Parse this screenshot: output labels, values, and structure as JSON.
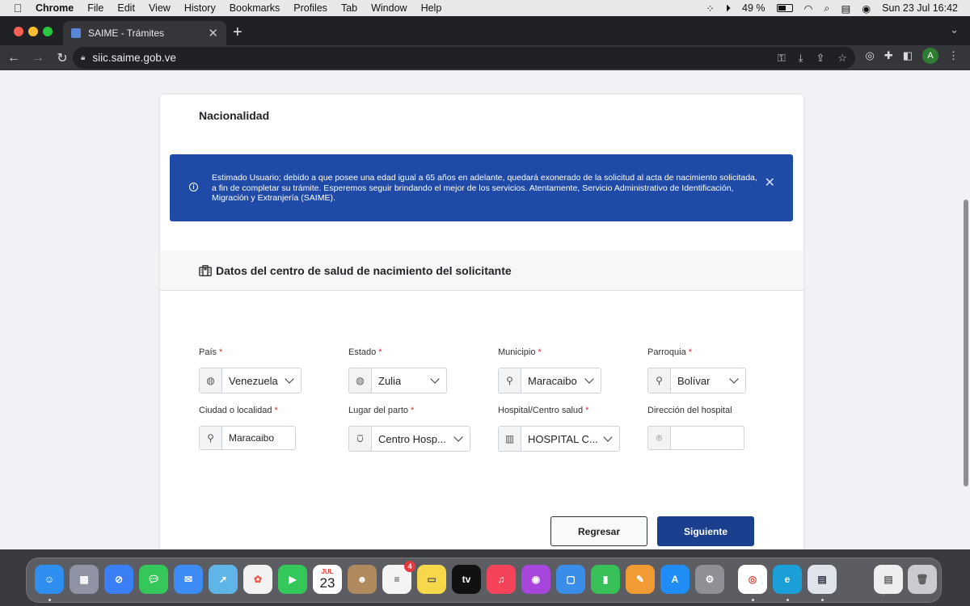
{
  "menubar": {
    "app": "Chrome",
    "items": [
      "File",
      "Edit",
      "View",
      "History",
      "Bookmarks",
      "Profiles",
      "Tab",
      "Window",
      "Help"
    ],
    "battery": "49 %",
    "datetime": "Sun 23 Jul  16:42"
  },
  "browser": {
    "tab_title": "SAIME - Trámites",
    "url": "siic.saime.gob.ve",
    "avatar_letter": "A"
  },
  "page": {
    "nacionalidad_title": "Nacionalidad",
    "alert_text": "Estimado Usuario; debido a que posee una edad igual a 65 años en adelante, quedará exonerado de la solicitud al acta de nacimiento solicitada, a fin de completar su trámite. Esperemos seguir brindando el mejor de los servicios. Atentamente, Servicio Administrativo de Identificación, Migración y Extranjería (SAIME).",
    "section_title": "Datos del centro de salud de nacimiento del solicitante",
    "fields": {
      "pais": {
        "label": "País",
        "value": "Venezuela"
      },
      "estado": {
        "label": "Estado",
        "value": "Zulia"
      },
      "municipio": {
        "label": "Municipio",
        "value": "Maracaibo"
      },
      "parroquia": {
        "label": "Parroquia",
        "value": "Bolívar"
      },
      "ciudad": {
        "label": "Ciudad o localidad",
        "value": "Maracaibo"
      },
      "lugar_parto": {
        "label": "Lugar del parto",
        "value": "Centro Hosp..."
      },
      "hospital": {
        "label": "Hospital/Centro salud",
        "value": "HOSPITAL C..."
      },
      "direccion": {
        "label": "Dirección del hospital",
        "value": ""
      }
    },
    "required_mark": "*",
    "buttons": {
      "back": "Regresar",
      "next": "Siguiente"
    }
  },
  "dock": {
    "calendar_month": "JUL",
    "calendar_day": "23",
    "reminders_badge": "4",
    "tv_label": "tv"
  },
  "colors": {
    "alert_bg": "#1f4aa8",
    "primary_button": "#1b3f8f",
    "required": "#d32f2f"
  }
}
